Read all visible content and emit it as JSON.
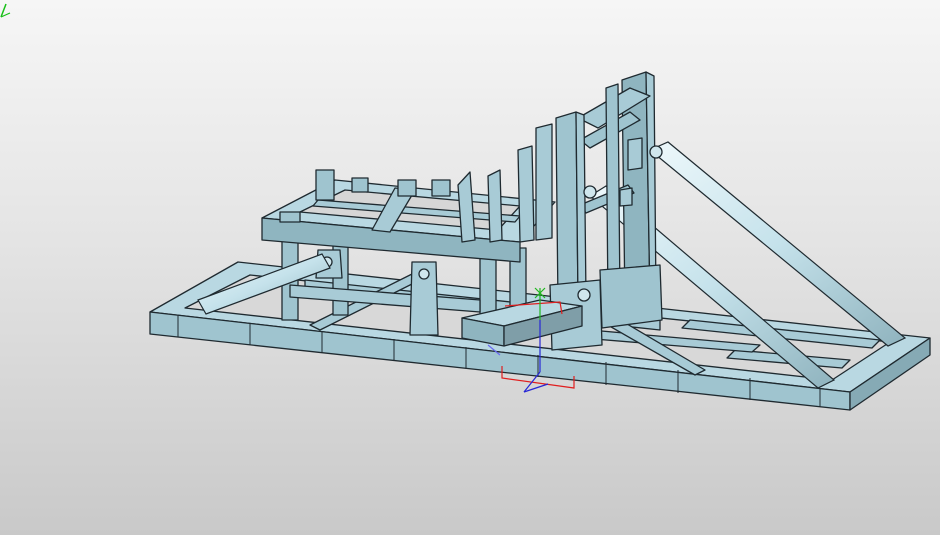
{
  "viewport": {
    "background_top": "#f6f6f6",
    "background_bottom": "#c9c9c9"
  },
  "model": {
    "face_color": "#b9d8e2",
    "edge_color": "#1f2a30",
    "shadow_color": "#7f9ea8",
    "tube_color": "#d4ebf2"
  },
  "triad": {
    "x_color": "#e01e1e",
    "y_color": "#1fb71f",
    "z_color": "#2626d6"
  },
  "corner_triad": {
    "icon": "mini-axis-icon",
    "color": "#18c018"
  }
}
